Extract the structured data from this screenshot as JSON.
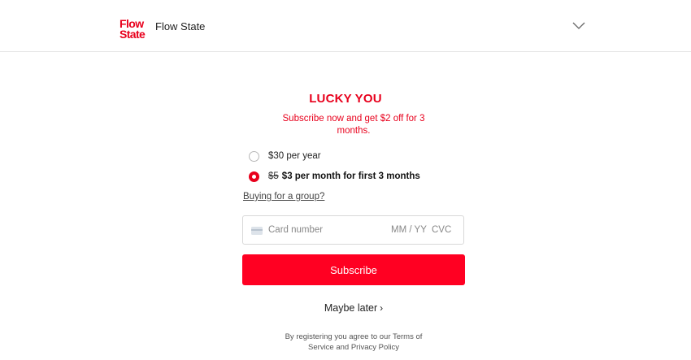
{
  "header": {
    "logo_line1": "Flow",
    "logo_line2": "State",
    "app_name": "Flow State",
    "menu_icon": "chevron-down-icon"
  },
  "promo": {
    "title": "LUCKY YOU",
    "subtitle": "Subscribe now and get $2 off for 3 months."
  },
  "plans": [
    {
      "label": "$30 per year",
      "selected": false
    },
    {
      "old_price": "$5",
      "label": "$3 per month for first 3 months",
      "selected": true
    }
  ],
  "group_link": "Buying for a group?",
  "card": {
    "icon": "credit-card-icon",
    "number_placeholder": "Card number",
    "expiry_placeholder": "MM / YY",
    "cvc_placeholder": "CVC"
  },
  "subscribe_label": "Subscribe",
  "maybe_later": {
    "label": "Maybe later",
    "arrow": "›"
  },
  "terms": "By registering you agree to our Terms of Service and Privacy Policy",
  "colors": {
    "brand": "#e8001c",
    "button": "#ff0022"
  }
}
